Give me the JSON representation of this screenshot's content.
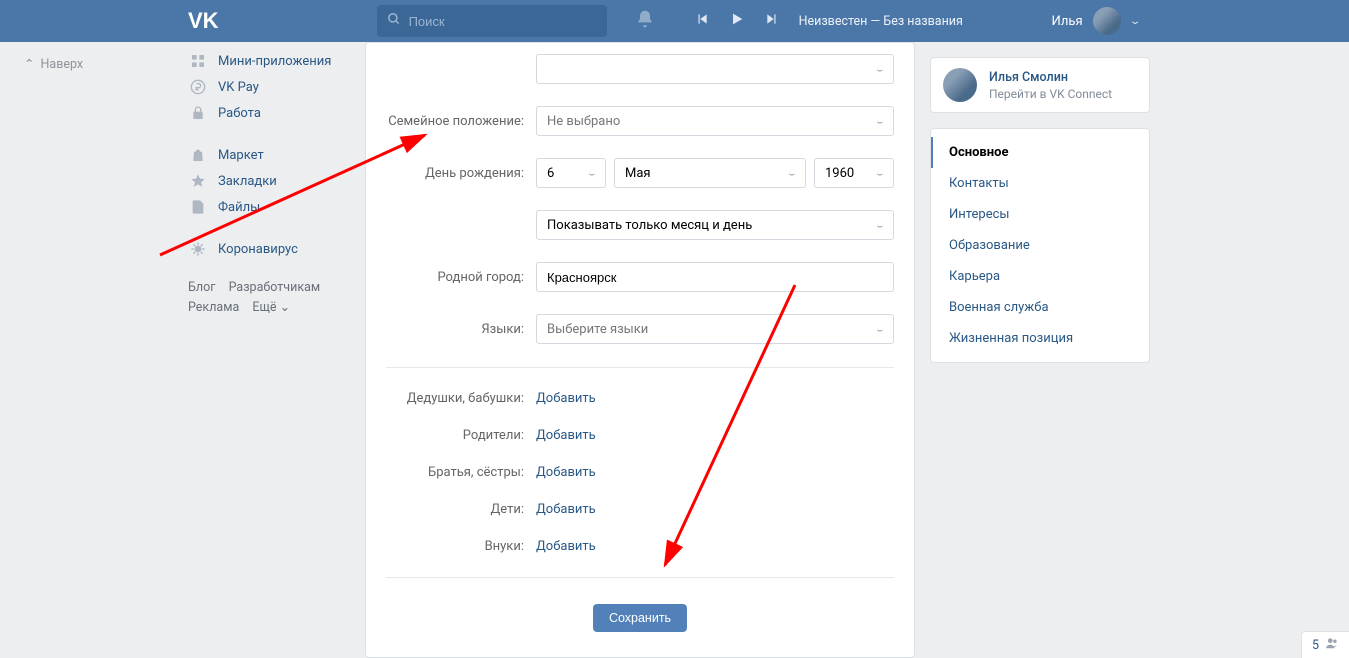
{
  "header": {
    "search_placeholder": "Поиск",
    "track": "Неизвестен — Без названия",
    "user_name": "Илья"
  },
  "top_link": "Наверх",
  "left_nav": {
    "items": [
      {
        "label": "Мини-приложения",
        "icon": "grid"
      },
      {
        "label": "VK Pay",
        "icon": "ruble"
      },
      {
        "label": "Работа",
        "icon": "lock"
      }
    ],
    "items2": [
      {
        "label": "Маркет",
        "icon": "bag"
      },
      {
        "label": "Закладки",
        "icon": "star"
      },
      {
        "label": "Файлы",
        "icon": "doc"
      }
    ],
    "items3": [
      {
        "label": "Коронавирус",
        "icon": "virus"
      }
    ],
    "footer": [
      "Блог",
      "Разработчикам",
      "Реклама",
      "Ещё"
    ]
  },
  "form": {
    "labels": {
      "marital": "Семейное положение:",
      "birthday": "День рождения:",
      "hometown": "Родной город:",
      "languages": "Языки:",
      "grandparents": "Дедушки, бабушки:",
      "parents": "Родители:",
      "siblings": "Братья, сёстры:",
      "children": "Дети:",
      "grandchildren": "Внуки:"
    },
    "marital_value": "Не выбрано",
    "birth_day": "6",
    "birth_month": "Мая",
    "birth_year": "1960",
    "birth_visibility": "Показывать только месяц и день",
    "hometown_value": "Красноярск",
    "languages_placeholder": "Выберите языки",
    "add_link": "Добавить",
    "save_button": "Сохранить"
  },
  "profile": {
    "name": "Илья Смолин",
    "connect": "Перейти в VK Connect"
  },
  "tabs": [
    {
      "label": "Основное",
      "active": true
    },
    {
      "label": "Контакты",
      "active": false
    },
    {
      "label": "Интересы",
      "active": false
    },
    {
      "label": "Образование",
      "active": false
    },
    {
      "label": "Карьера",
      "active": false
    },
    {
      "label": "Военная служба",
      "active": false
    },
    {
      "label": "Жизненная позиция",
      "active": false
    }
  ],
  "more_count": "5"
}
